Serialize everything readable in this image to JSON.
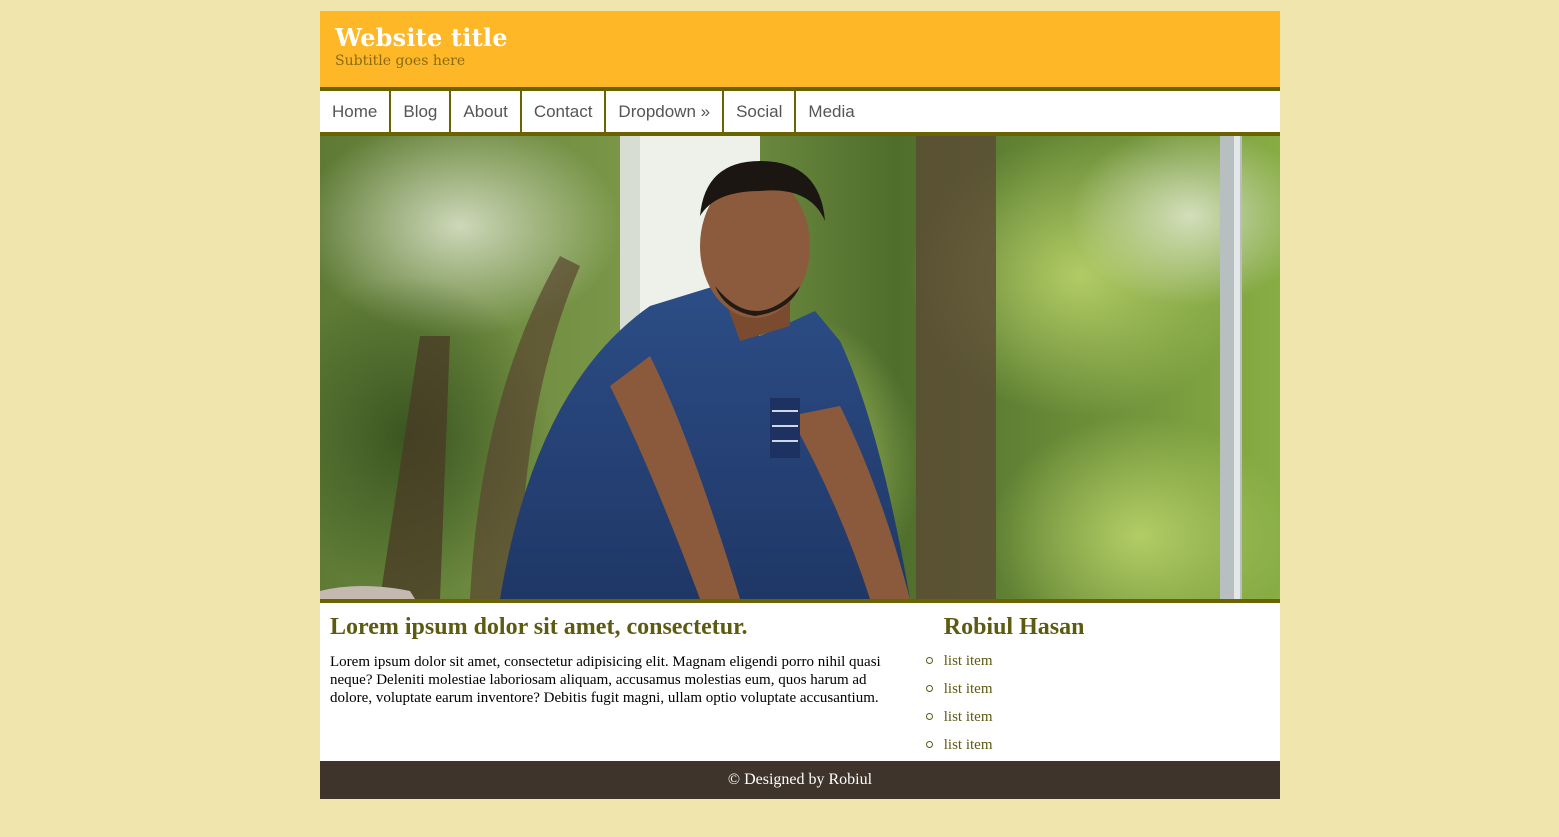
{
  "header": {
    "title": "Website title",
    "subtitle": "Subtitle goes here"
  },
  "nav": {
    "items": [
      {
        "label": "Home"
      },
      {
        "label": "Blog"
      },
      {
        "label": "About"
      },
      {
        "label": "Contact"
      },
      {
        "label": "Dropdown »"
      },
      {
        "label": "Social"
      },
      {
        "label": "Media"
      }
    ]
  },
  "hero": {
    "image_description_icon": "person-photo"
  },
  "main": {
    "heading": "Lorem ipsum dolor sit amet, consectetur.",
    "paragraph": "Lorem ipsum dolor sit amet, consectetur adipisicing elit. Magnam eligendi porro nihil quasi neque? Deleniti molestiae laboriosam aliquam, accusamus molestias eum, quos harum ad dolore, voluptate earum inventore? Debitis fugit magni, ullam optio voluptate accusantium."
  },
  "sidebar": {
    "heading": "Robiul Hasan",
    "items": [
      "list item",
      "list item",
      "list item",
      "list item"
    ]
  },
  "footer": {
    "text": "© Designed by Robiul"
  },
  "colors": {
    "page_background": "#f0e5ad",
    "header_background": "#fdb727",
    "accent_border": "#6b6200",
    "heading_color": "#5d5a12",
    "footer_background": "#3e342b"
  }
}
